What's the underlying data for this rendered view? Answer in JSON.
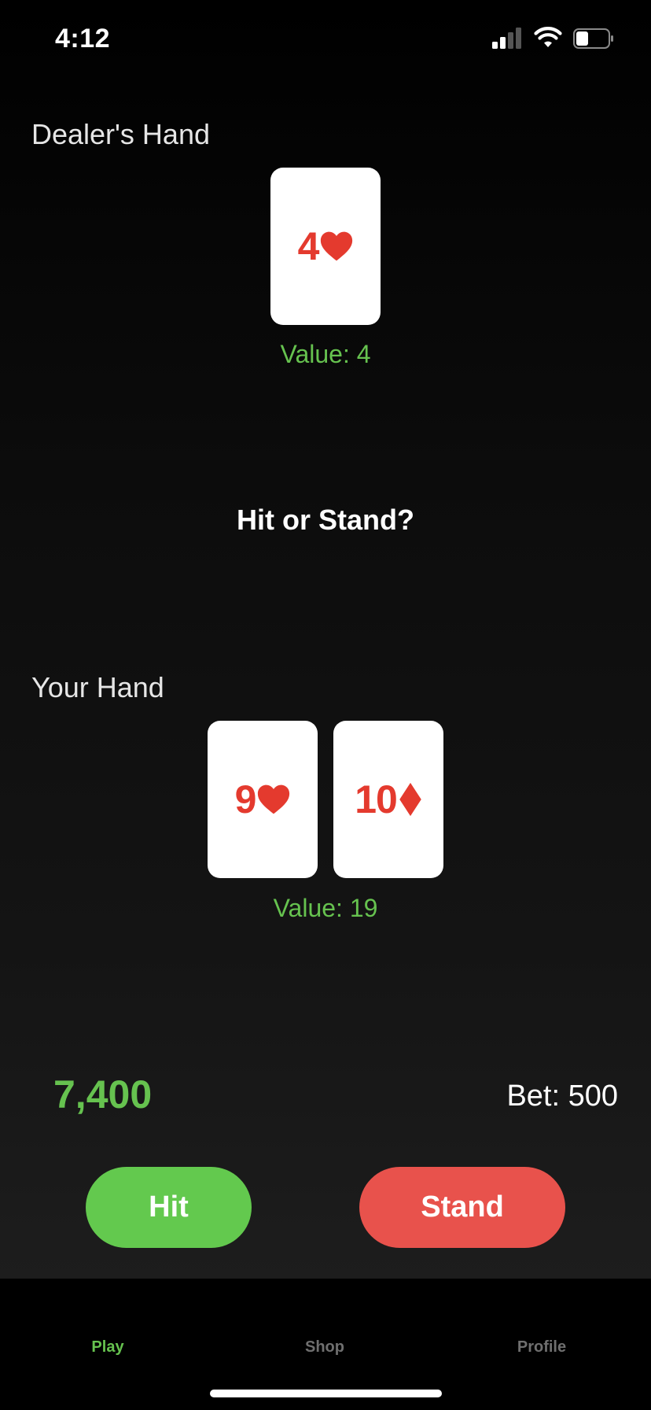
{
  "status_bar": {
    "time": "4:12"
  },
  "dealer": {
    "label": "Dealer's Hand",
    "cards": [
      {
        "rank": "4",
        "suit": "heart"
      }
    ],
    "value_text": "Value: 4"
  },
  "prompt": "Hit or Stand?",
  "player": {
    "label": "Your Hand",
    "cards": [
      {
        "rank": "9",
        "suit": "heart"
      },
      {
        "rank": "10",
        "suit": "diamond"
      }
    ],
    "value_text": "Value: 19"
  },
  "balance": "7,400",
  "bet": "Bet: 500",
  "actions": {
    "hit": "Hit",
    "stand": "Stand"
  },
  "tabs": [
    {
      "label": "Play",
      "active": true
    },
    {
      "label": "Shop",
      "active": false
    },
    {
      "label": "Profile",
      "active": false
    }
  ],
  "colors": {
    "accent_green": "#66c24f",
    "stand_red": "#e8524c",
    "card_red": "#e43a2e"
  }
}
